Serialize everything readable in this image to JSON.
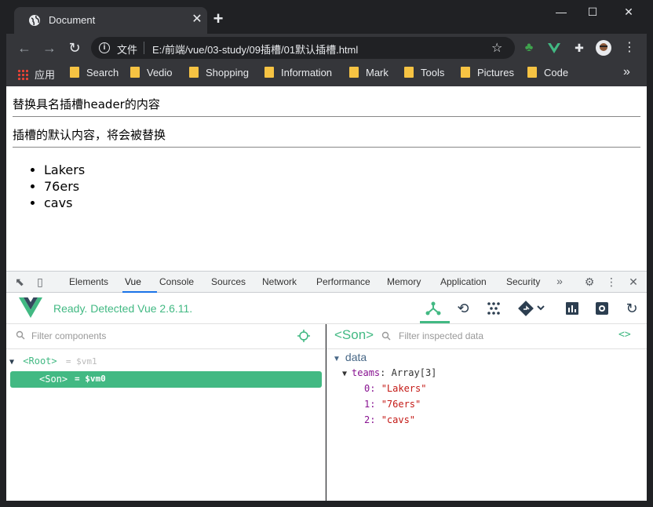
{
  "window": {
    "tab_title": "Document",
    "tab_close": "✕",
    "new_tab": "+",
    "minimize": "—",
    "maximize": "☐",
    "close": "✕"
  },
  "toolbar": {
    "url_label": "文件",
    "url": "E:/前端/vue/03-study/09插槽/01默认插槽.html"
  },
  "bookmarks": {
    "items": [
      {
        "label": "应用",
        "icon": "apps-grid-icon"
      },
      {
        "label": "Search",
        "icon": "folder-icon"
      },
      {
        "label": "Vedio",
        "icon": "folder-icon"
      },
      {
        "label": "Shopping",
        "icon": "folder-icon"
      },
      {
        "label": "Information",
        "icon": "folder-icon"
      },
      {
        "label": "Mark",
        "icon": "folder-icon"
      },
      {
        "label": "Tools",
        "icon": "folder-icon"
      },
      {
        "label": "Pictures",
        "icon": "folder-icon"
      },
      {
        "label": "Code",
        "icon": "folder-icon"
      }
    ],
    "more": "»"
  },
  "page": {
    "header_text": "替换具名插槽header的内容",
    "default_text": "插槽的默认内容，将会被替换",
    "teams": [
      "Lakers",
      "76ers",
      "cavs"
    ]
  },
  "devtools": {
    "tabs": [
      "Elements",
      "Vue",
      "Console",
      "Sources",
      "Network",
      "Performance",
      "Memory",
      "Application",
      "Security"
    ],
    "active_tab": "Vue",
    "more": "»"
  },
  "vue": {
    "status": "Ready. Detected Vue 2.6.11.",
    "filter_components_placeholder": "Filter components",
    "tree": {
      "root_label": "<Root>",
      "root_ref": "= $vm1",
      "son_label": "<Son>",
      "son_ref": "= $vm0"
    },
    "inspector": {
      "title": "<Son>",
      "filter_placeholder": "Filter inspected data",
      "code_icon": "<>",
      "section": "data",
      "prop_key": "teams",
      "prop_type": "Array[3]",
      "items": [
        {
          "index": "0:",
          "value": "\"Lakers\""
        },
        {
          "index": "1:",
          "value": "\"76ers\""
        },
        {
          "index": "2:",
          "value": "\"cavs\""
        }
      ]
    }
  },
  "colors": {
    "vue_green": "#42b983",
    "chrome_dark": "#202124",
    "chrome_toolbar": "#35363a"
  }
}
